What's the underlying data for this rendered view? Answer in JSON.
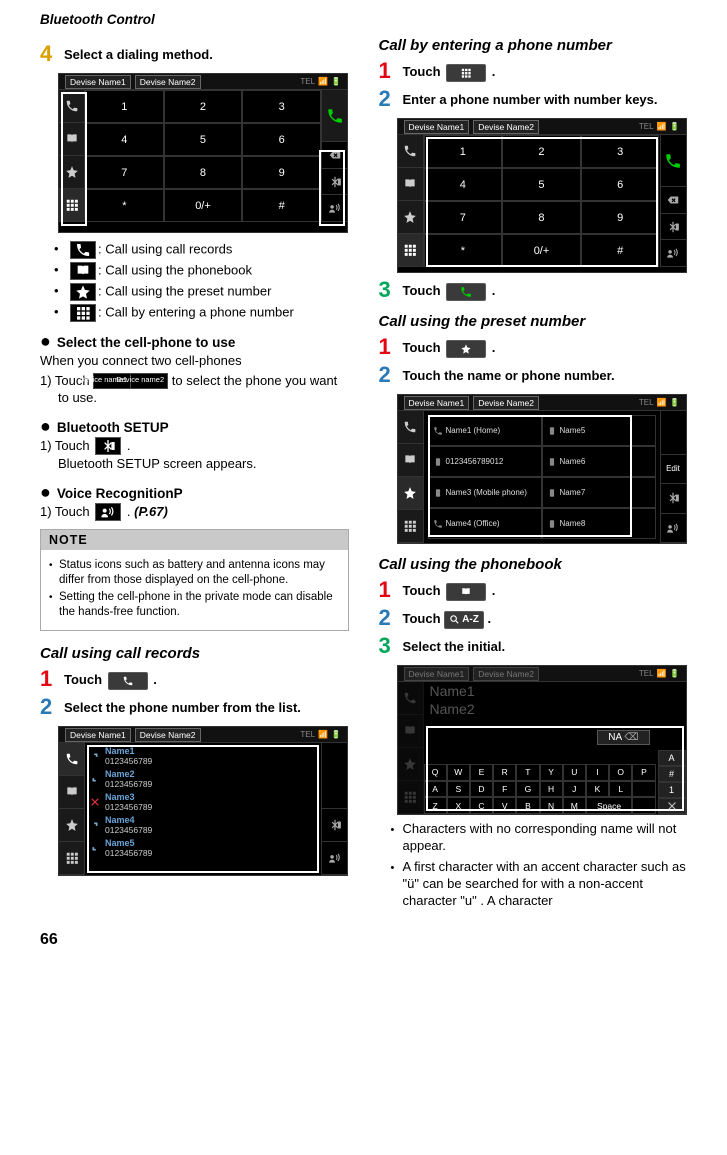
{
  "header": "Bluetooth Control",
  "page_number": "66",
  "left": {
    "step4": "Select a dialing method.",
    "action_descr": {
      "records": ": Call using call records",
      "phonebook": ": Call using the phonebook",
      "preset": ": Call using the preset number",
      "number": ": Call by entering a phone number"
    },
    "sel_head": "Select the cell-phone to use",
    "sel_body1": "When you connect two cell-phones",
    "sel_body2a": "1) Touch ",
    "sel_body2b": " to select the phone you want to use.",
    "devpair": {
      "a": "Device name1",
      "b": "Device name2"
    },
    "bt_head": "Bluetooth SETUP",
    "bt_body1": "1) Touch ",
    "bt_body1b": ".",
    "bt_body2": "Bluetooth SETUP screen appears.",
    "vr_head": "Voice RecognitionP",
    "vr_body1a": "1) Touch ",
    "vr_body1b": ". ",
    "vr_link": "(P.67)",
    "note_head": "NOTE",
    "note1": "Status icons such as battery and antenna icons may differ from those displayed on the cell-phone.",
    "note2": "Setting the cell-phone in the private mode can disable the hands-free function.",
    "rec_head": "Call using call records",
    "rec_s1": "Touch ",
    "rec_s2": "Select the phone number from the list."
  },
  "right": {
    "num_head": "Call by entering a phone number",
    "num_s1": "Touch ",
    "num_s2": "Enter a phone number with number keys.",
    "num_s3": "Touch ",
    "pre_head": "Call using the preset number",
    "pre_s1": "Touch ",
    "pre_s2": "Touch the name or phone number.",
    "pb_head": "Call using the phonebook",
    "pb_s1": "Touch ",
    "pb_s2a": "Touch ",
    "pb_s2b": "A-Z",
    "pb_s3": "Select the initial.",
    "foot1": "Characters with no corresponding name will not appear.",
    "foot2": "A first character with an accent character such as \"ü\" can be searched for with a non-accent character \"u\" . A character"
  },
  "shots": {
    "tabs": {
      "d1": "Devise Name1",
      "d2": "Devise Name2",
      "tel": "TEL"
    },
    "keypad": [
      "1",
      "2",
      "3",
      "4",
      "5",
      "6",
      "7",
      "8",
      "9",
      "*",
      "0/+",
      "#"
    ],
    "records": [
      {
        "name": "Name1",
        "num": "0123456789"
      },
      {
        "name": "Name2",
        "num": "0123456789"
      },
      {
        "name": "Name3",
        "num": "0123456789"
      },
      {
        "name": "Name4",
        "num": "0123456789"
      },
      {
        "name": "Name5",
        "num": "0123456789"
      }
    ],
    "preset": [
      {
        "l": "Name1 (Home)",
        "r": "Name5"
      },
      {
        "l": "0123456789012",
        "r": "Name6"
      },
      {
        "l": "Name3 (Mobile phone)",
        "r": "Name7"
      },
      {
        "l": "Name4 (Office)",
        "r": "Name8"
      }
    ],
    "edit": "Edit",
    "pb_dim": [
      "Name1",
      "Name2"
    ],
    "na": "NA",
    "kbd": [
      "Q",
      "W",
      "E",
      "R",
      "T",
      "Y",
      "U",
      "I",
      "O",
      "P",
      "A",
      "S",
      "D",
      "F",
      "G",
      "H",
      "J",
      "K",
      "L",
      "Z",
      "X",
      "C",
      "V",
      "B",
      "N",
      "M",
      "Space"
    ],
    "kbd_side": [
      "A",
      "#",
      "1"
    ]
  }
}
